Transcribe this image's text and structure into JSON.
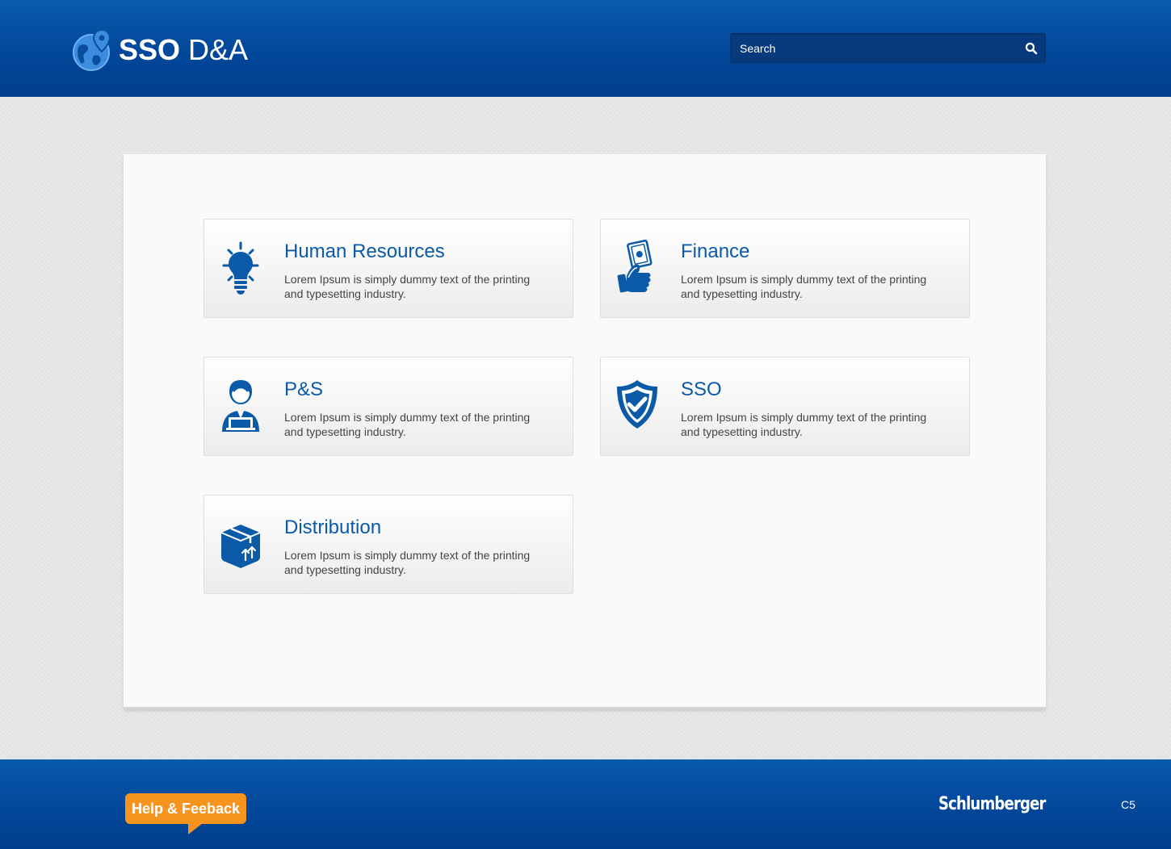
{
  "header": {
    "logo_bold": "SSO",
    "logo_light": " D&A",
    "search_placeholder": "Search"
  },
  "cards": [
    {
      "title": "Human Resources",
      "desc": "Lorem Ipsum is simply dummy text of the printing and typesetting industry.",
      "icon": "lightbulb-icon"
    },
    {
      "title": "Finance",
      "desc": "Lorem Ipsum is simply dummy text of the printing and typesetting industry.",
      "icon": "money-hand-icon"
    },
    {
      "title": "P&S",
      "desc": "Lorem Ipsum is simply dummy text of the printing and typesetting industry.",
      "icon": "person-laptop-icon"
    },
    {
      "title": "SSO",
      "desc": "Lorem Ipsum is simply dummy text of the printing and typesetting industry.",
      "icon": "shield-check-icon"
    },
    {
      "title": "Distribution",
      "desc": "Lorem Ipsum is simply dummy text of the printing and typesetting industry.",
      "icon": "box-icon"
    }
  ],
  "footer": {
    "help_label": "Help & Feeback",
    "brand": "Schlumberger",
    "version": "C5"
  },
  "colors": {
    "header_blue": "#02479a",
    "accent_blue": "#0a5aa8",
    "help_orange": "#f7941d"
  }
}
